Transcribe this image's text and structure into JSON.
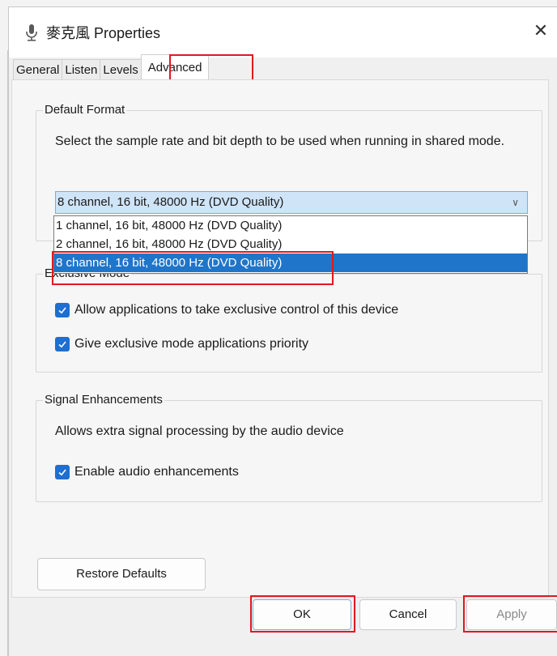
{
  "window": {
    "title": "麥克風 Properties",
    "close_label": "✕"
  },
  "tabs": [
    {
      "label": "General"
    },
    {
      "label": "Listen"
    },
    {
      "label": "Levels"
    },
    {
      "label": "Advanced",
      "active": true
    }
  ],
  "default_format": {
    "title": "Default Format",
    "description": "Select the sample rate and bit depth to be used when running in shared mode.",
    "selected": "8 channel, 16 bit, 48000 Hz (DVD Quality)",
    "options": [
      "1 channel, 16 bit, 48000 Hz (DVD Quality)",
      "2 channel, 16 bit, 48000 Hz (DVD Quality)",
      "8 channel, 16 bit, 48000 Hz (DVD Quality)"
    ],
    "highlighted_option_index": 2
  },
  "exclusive_mode": {
    "title": "Exclusive Mode",
    "allow_exclusive": {
      "label": "Allow applications to take exclusive control of this device",
      "checked": true
    },
    "give_priority": {
      "label": "Give exclusive mode applications priority",
      "checked": true
    }
  },
  "signal_enhancements": {
    "title": "Signal Enhancements",
    "description": "Allows extra signal processing by the audio device",
    "enable": {
      "label": "Enable audio enhancements",
      "checked": true
    }
  },
  "buttons": {
    "restore_defaults": "Restore Defaults",
    "ok": "OK",
    "cancel": "Cancel",
    "apply": "Apply"
  },
  "colors": {
    "accent": "#1d6fd1",
    "selection": "#1f75c9",
    "annotation_red": "#e0191f"
  }
}
